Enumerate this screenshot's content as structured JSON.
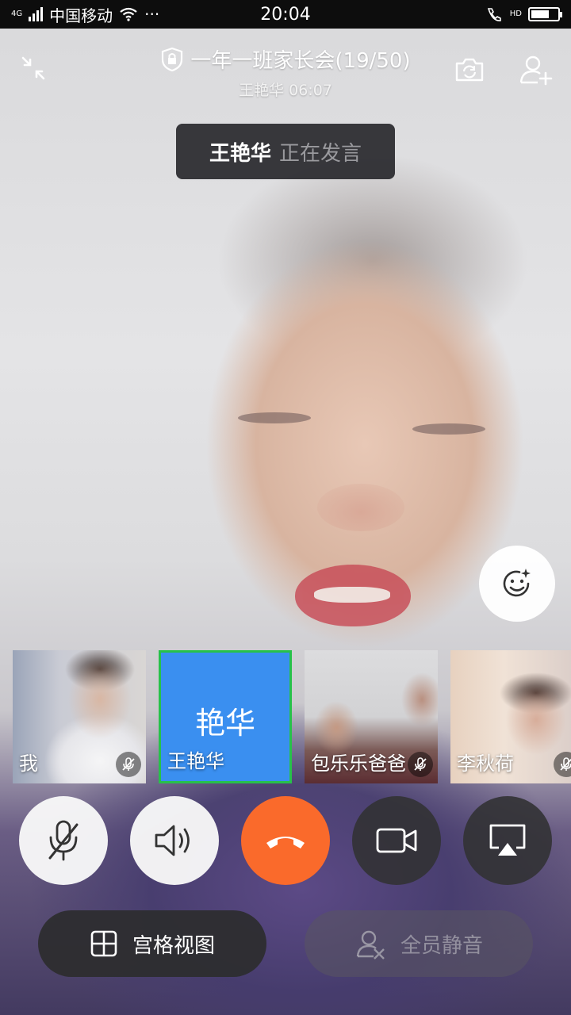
{
  "status_bar": {
    "network_type": "4G",
    "carrier": "中国移动",
    "more": "···",
    "time": "20:04",
    "hd_label": "HD"
  },
  "meeting": {
    "title": "一年一班家长会(19/50)",
    "subtitle": "王艳华 06:07"
  },
  "speaking_toast": {
    "name": "王艳华",
    "state": "正在发言"
  },
  "participants": [
    {
      "label": "我",
      "muted": true
    },
    {
      "avatar_text": "艳华",
      "label": "王艳华",
      "active": true,
      "active_border_color": "#27c14a",
      "tile_color": "#3a8ff0"
    },
    {
      "label": "包乐乐爸爸",
      "muted": true
    },
    {
      "label": "李秋荷",
      "muted": true
    }
  ],
  "controls": {
    "hangup_color": "#fa6a2b"
  },
  "bottom": {
    "grid_view_label": "宫格视图",
    "mute_all_label": "全员静音"
  },
  "icons": [
    "lock-icon",
    "minimize-icon",
    "switch-camera-icon",
    "add-member-icon",
    "face-effects-icon",
    "mic-off-icon",
    "speaker-icon",
    "hangup-icon",
    "camera-icon",
    "screen-share-icon",
    "grid-icon",
    "mute-all-icon",
    "wifi-icon",
    "hd-call-icon",
    "battery-icon"
  ]
}
